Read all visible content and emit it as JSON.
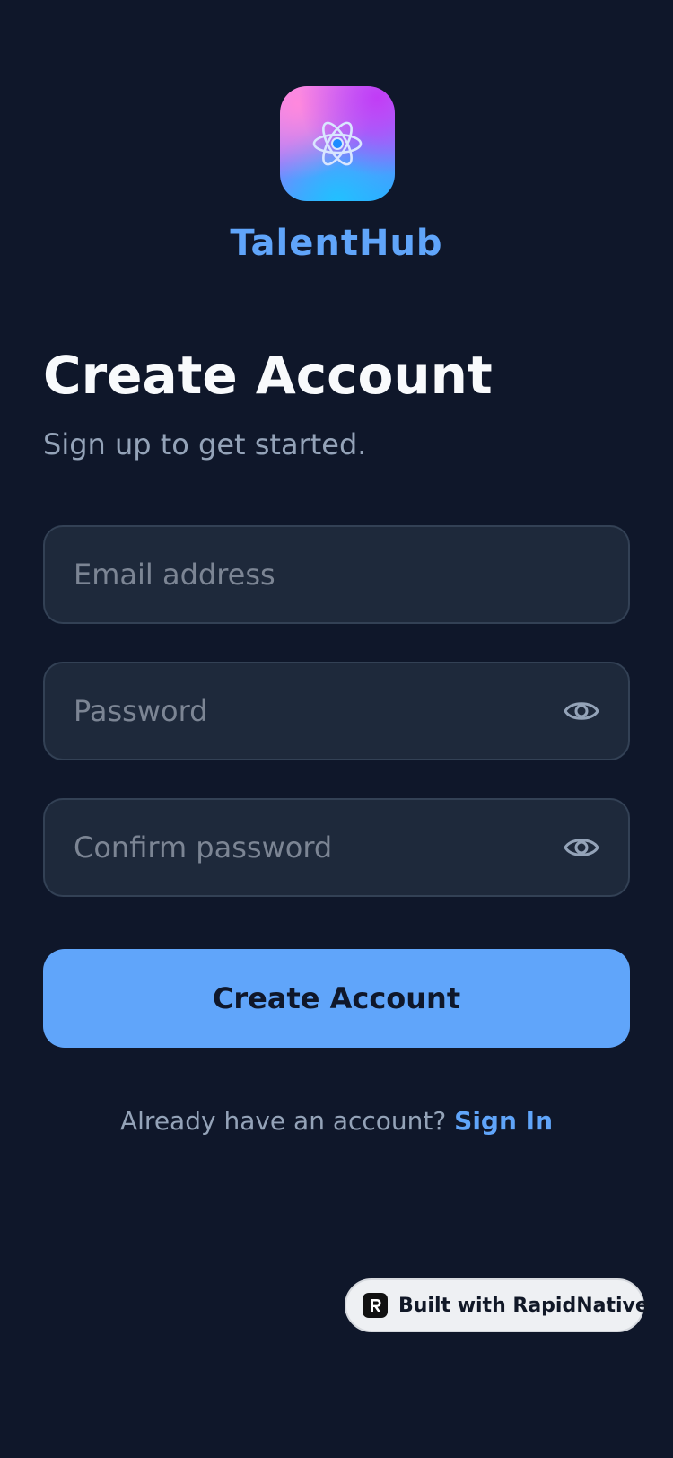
{
  "brand": {
    "logo_icon": "atom-icon",
    "name": "TalentHub"
  },
  "header": {
    "title": "Create Account",
    "subtitle": "Sign up to get started."
  },
  "form": {
    "email": {
      "placeholder": "Email address",
      "value": ""
    },
    "password": {
      "placeholder": "Password",
      "value": "",
      "toggle_icon": "eye-icon"
    },
    "confirm_password": {
      "placeholder": "Confirm password",
      "value": "",
      "toggle_icon": "eye-icon"
    },
    "submit_label": "Create Account"
  },
  "footer": {
    "prompt": "Already have an account? ",
    "link_label": "Sign In"
  },
  "badge": {
    "icon": "rapidnative-logo-icon",
    "label": "Built with RapidNative"
  },
  "colors": {
    "background": "#0f172a",
    "accent": "#60a5fa",
    "field_bg": "#1e293b",
    "field_border": "#334155",
    "muted_text": "#94a3b8"
  }
}
